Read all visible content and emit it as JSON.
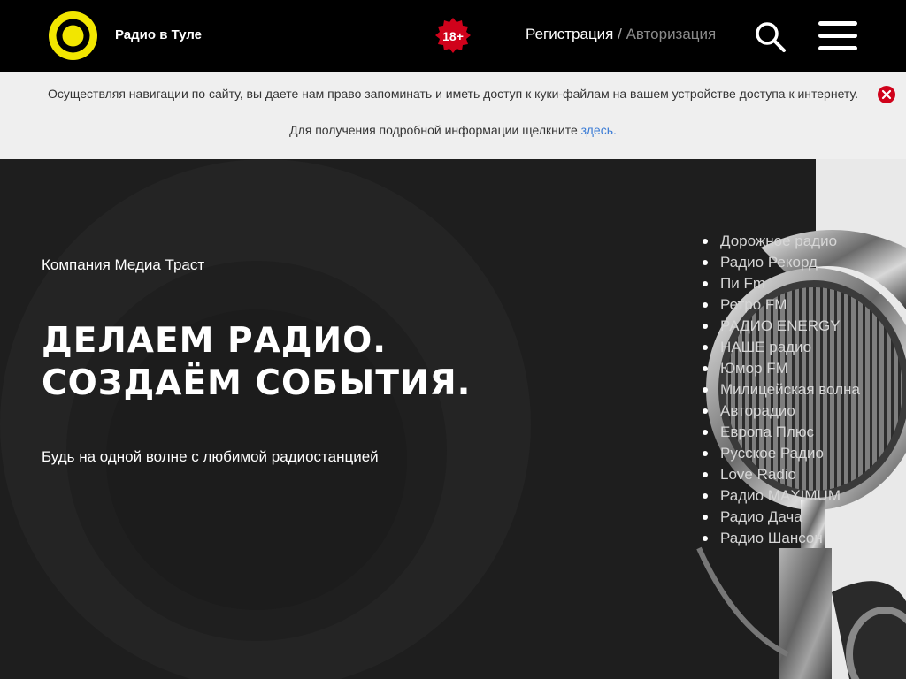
{
  "header": {
    "site_title": "Радио в Туле",
    "age_rating": "18+",
    "register_label": "Регистрация",
    "separator": " / ",
    "login_label": "Авторизация"
  },
  "cookie_notice": {
    "text": "Осуществляя навигации по сайту, вы даете нам право запоминать и иметь доступ к куки-файлам на вашем устройстве доступа к интернету.",
    "more_prefix": "Для получения подробной информации щелкните ",
    "more_link": "здесь."
  },
  "hero": {
    "company": "Компания Медиа Траст",
    "headline_line1": "ДЕЛАЕМ РАДИО.",
    "headline_line2": "СОЗДАЁМ СОБЫТИЯ.",
    "tagline": "Будь на одной волне с любимой радиостанцией"
  },
  "stations": [
    "Дорожное радио",
    "Радио Рекорд",
    "Пи Fm",
    "Ретро FM",
    "РАДИО ENERGY",
    "НАШЕ радио",
    "Юмор FM",
    "Милицейская волна",
    "Авторадио",
    "Европа Плюс",
    "Русское Радио",
    "Love Radio",
    "Радио MAXIMUM",
    "Радио Дача",
    "Радио Шансон"
  ],
  "colors": {
    "brand_yellow": "#f2e600",
    "header_bg": "#000000",
    "age_badge": "#d0021b",
    "cookie_link": "#3a7bd5",
    "hero_bg": "#1e1e1e"
  },
  "icons": [
    "logo-icon",
    "age-rating-badge",
    "search-icon",
    "menu-icon",
    "close-icon",
    "microphone-image"
  ]
}
